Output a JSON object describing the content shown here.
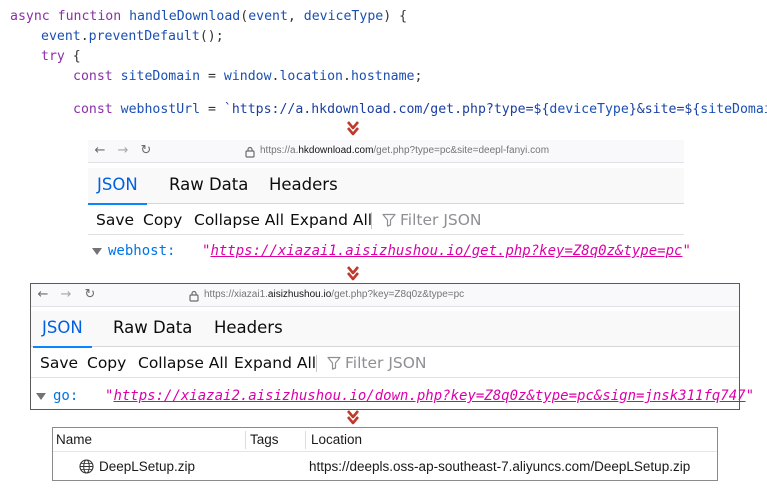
{
  "code": {
    "line1": {
      "kw": "async function ",
      "fn": "handleDownload",
      "open": "(",
      "p1": "event",
      "comma": ", ",
      "p2": "deviceType",
      "close": ") {"
    },
    "line2": {
      "obj": "event",
      "dot": ".",
      "method": "preventDefault",
      "rest": "();"
    },
    "line3": {
      "kw": "try",
      "rest": " {"
    },
    "line4": {
      "kw": "const ",
      "var": "siteDomain",
      "eq": " = ",
      "obj": "window",
      "d1": ".",
      "p1": "location",
      "d2": ".",
      "p2": "hostname",
      "end": ";"
    },
    "line5": {
      "kw": "const ",
      "var": "webhostUrl",
      "eq": " = ",
      "s1": "`https://a.hkdownload.com/get.php?type=${",
      "v1": "deviceType",
      "s2": "}&site=${",
      "v2": "siteDomain",
      "s3": "}`",
      "end": ";"
    }
  },
  "panel1": {
    "back_glyph": "←",
    "forward_glyph": "→",
    "reload_glyph": "↻",
    "url_prefix": "https://a.",
    "url_host": "hkdownload.com",
    "url_rest": "/get.php?type=pc&site=deepl-fanyi.com",
    "tabs": [
      "JSON",
      "Raw Data",
      "Headers"
    ],
    "toolbar": [
      "Save",
      "Copy",
      "Collapse All",
      "Expand All"
    ],
    "filter_placeholder": "Filter JSON",
    "row_key": "webhost:",
    "row_value": "https://xiazai1.aisizhushou.io/get.php?key=Z8q0z&type=pc",
    "quote": "\""
  },
  "panel2": {
    "back_glyph": "←",
    "forward_glyph": "→",
    "reload_glyph": "↻",
    "url_prefix": "https://xiazai1.",
    "url_host": "aisizhushou.io",
    "url_rest": "/get.php?key=Z8q0z&type=pc",
    "tabs": [
      "JSON",
      "Raw Data",
      "Headers"
    ],
    "toolbar": [
      "Save",
      "Copy",
      "Collapse All",
      "Expand All"
    ],
    "filter_placeholder": "Filter JSON",
    "row_key": "go:",
    "row_value": "https://xiazai2.aisizhushou.io/down.php?key=Z8q0z&type=pc&sign=jnsk311fq747",
    "quote": "\""
  },
  "files": {
    "columns": [
      "Name",
      "Tags",
      "Location"
    ],
    "row": {
      "name": "DeepLSetup.zip",
      "tags": "",
      "location": "https://deepls.oss-ap-southeast-7.aliyuncs.com/DeepLSetup.zip"
    }
  },
  "colors": {
    "arrow": "#c0392b",
    "active_tab": "#0060df",
    "json_key": "#0074e8",
    "json_string": "#dd00a9"
  },
  "icons": [
    "arrow-down-icon",
    "lock-icon",
    "filter-icon",
    "globe-icon",
    "expand-triangle-icon"
  ]
}
